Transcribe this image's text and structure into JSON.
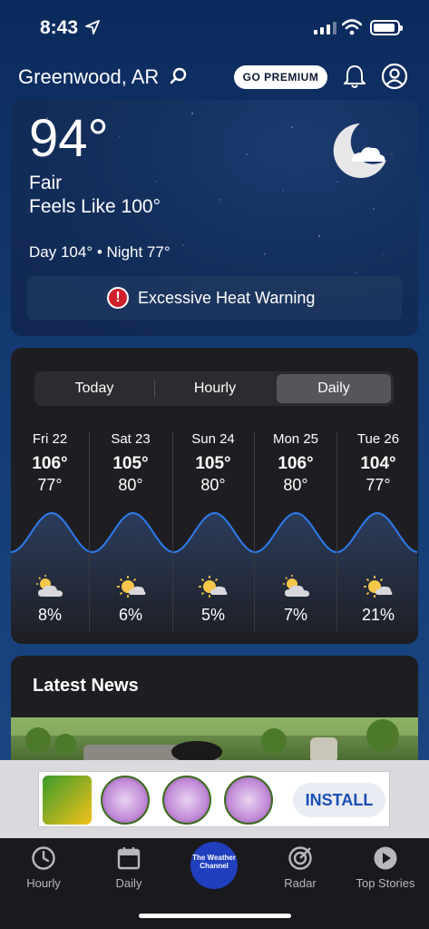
{
  "status_bar": {
    "time": "8:43"
  },
  "header": {
    "location": "Greenwood, AR",
    "premium_label": "GO PREMIUM"
  },
  "current": {
    "temperature": "94°",
    "condition": "Fair",
    "feels_like": "Feels Like 100°",
    "day_night": "Day 104° • Night 77°",
    "alert": "Excessive Heat Warning"
  },
  "forecast": {
    "tabs": [
      "Today",
      "Hourly",
      "Daily"
    ],
    "active_tab": "Daily",
    "days": [
      {
        "name": "Fri 22",
        "hi": "106°",
        "lo": "77°",
        "icon": "partly-cloudy-icon",
        "precip": "8%"
      },
      {
        "name": "Sat 23",
        "hi": "105°",
        "lo": "80°",
        "icon": "sun-cloud-icon",
        "precip": "6%"
      },
      {
        "name": "Sun 24",
        "hi": "105°",
        "lo": "80°",
        "icon": "sun-cloud-icon",
        "precip": "5%"
      },
      {
        "name": "Mon 25",
        "hi": "106°",
        "lo": "80°",
        "icon": "partly-cloudy-icon",
        "precip": "7%"
      },
      {
        "name": "Tue 26",
        "hi": "104°",
        "lo": "77°",
        "icon": "sun-cloud-icon",
        "precip": "21%"
      }
    ]
  },
  "news": {
    "title": "Latest News"
  },
  "ad": {
    "install_label": "INSTALL"
  },
  "tabbar": {
    "items": [
      {
        "label": "Hourly"
      },
      {
        "label": "Daily"
      },
      {
        "label": "The Weather Channel"
      },
      {
        "label": "Radar"
      },
      {
        "label": "Top Stories"
      }
    ]
  },
  "colors": {
    "accent": "#1f3fbf",
    "alert": "#d0202b",
    "wave": "#2f7bf0"
  }
}
